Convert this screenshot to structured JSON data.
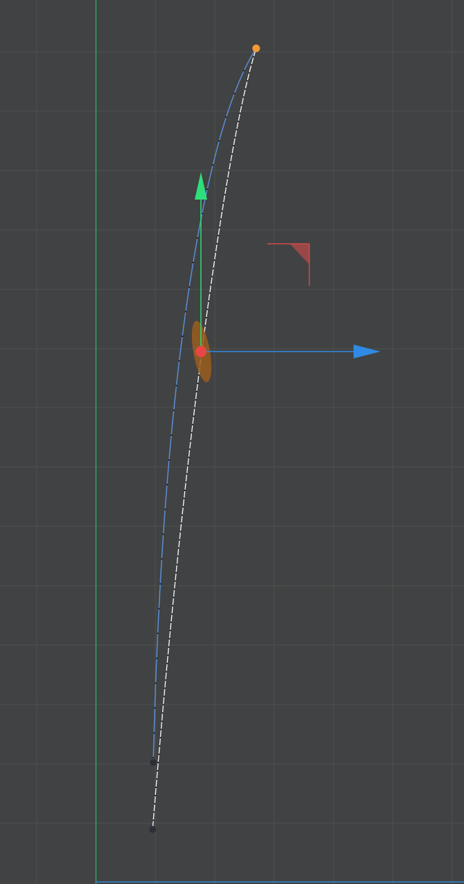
{
  "viewport": {
    "kind": "3d-spline-editor-front-view",
    "background_color": "#414243",
    "grid_color": "#4f5152",
    "world_axis_color": "#2fb86a",
    "bottom_axis_color": "#3a77b0",
    "grid_visible": true
  },
  "spline": {
    "curve_color": "#5b8fd6",
    "tangent_color": "#ffffff",
    "start_point_color": "#f39a36",
    "end_point_color": "#2a3036",
    "points": [
      "start-point",
      "end-point",
      "tangent-handle-point"
    ]
  },
  "move_gizmo": {
    "x_axis_color": "#2f8ae5",
    "y_axis_color": "#2fe07a",
    "origin_color": "#e84545",
    "orientation_disc_color": "#9b5d1c",
    "plane_handle_color": "#d24a4a",
    "icons": [
      "x-axis-arrow-icon",
      "y-axis-arrow-icon",
      "xy-plane-handle-icon",
      "gizmo-origin-icon"
    ]
  }
}
